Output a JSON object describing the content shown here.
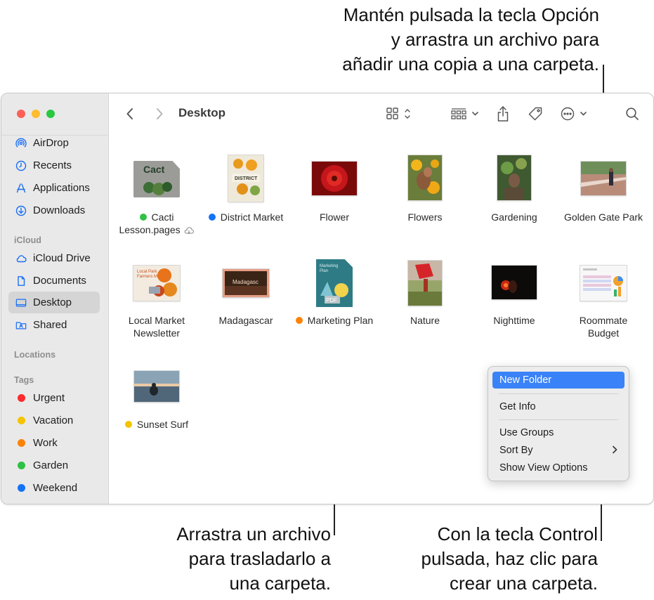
{
  "callouts": {
    "top_right": [
      "Mantén pulsada la tecla Opción",
      "y arrastra un archivo para",
      "añadir una copia a una carpeta."
    ],
    "bottom_middle": [
      "Arrastra un archivo",
      "para trasladarlo a",
      "una carpeta."
    ],
    "bottom_right": [
      "Con la tecla Control",
      "pulsada, haz clic para",
      "crear una carpeta."
    ]
  },
  "window": {
    "title": "Desktop"
  },
  "sidebar": {
    "favorites": [
      {
        "label": "AirDrop",
        "icon": "airdrop-icon"
      },
      {
        "label": "Recents",
        "icon": "clock-icon"
      },
      {
        "label": "Applications",
        "icon": "applications-icon"
      },
      {
        "label": "Downloads",
        "icon": "download-icon"
      }
    ],
    "icloud_header": "iCloud",
    "icloud": [
      {
        "label": "iCloud Drive",
        "icon": "cloud-icon"
      },
      {
        "label": "Documents",
        "icon": "document-icon"
      },
      {
        "label": "Desktop",
        "icon": "desktop-icon",
        "selected": true
      },
      {
        "label": "Shared",
        "icon": "shared-folder-icon"
      }
    ],
    "locations_header": "Locations",
    "tags_header": "Tags",
    "tags": [
      {
        "label": "Urgent",
        "color": "#fc2b2d"
      },
      {
        "label": "Vacation",
        "color": "#f5c400"
      },
      {
        "label": "Work",
        "color": "#fd8208"
      },
      {
        "label": "Garden",
        "color": "#2fc145"
      },
      {
        "label": "Weekend",
        "color": "#1473f5"
      }
    ]
  },
  "toolbar": {
    "icons": [
      "back-icon",
      "forward-icon",
      "grid-view-icon",
      "group-icon",
      "share-icon",
      "tag-icon",
      "more-icon",
      "search-icon"
    ]
  },
  "files": [
    {
      "line1": "Cacti",
      "line2": "Lesson.pages",
      "tag": "#2fc145",
      "icloud": true
    },
    {
      "line1": "District Market",
      "line2": "",
      "tag": "#1473f5"
    },
    {
      "line1": "Flower",
      "line2": ""
    },
    {
      "line1": "Flowers",
      "line2": ""
    },
    {
      "line1": "Gardening",
      "line2": ""
    },
    {
      "line1": "Golden Gate Park",
      "line2": ""
    },
    {
      "line1": "Local Market",
      "line2": "Newsletter"
    },
    {
      "line1": "Madagascar",
      "line2": ""
    },
    {
      "line1": "Marketing Plan",
      "line2": "",
      "tag": "#fd8208"
    },
    {
      "line1": "Nature",
      "line2": ""
    },
    {
      "line1": "Nighttime",
      "line2": ""
    },
    {
      "line1": "Roommate",
      "line2": "Budget"
    },
    {
      "line1": "Sunset Surf",
      "line2": "",
      "tag": "#f5c400"
    }
  ],
  "context_menu": {
    "new_folder": "New Folder",
    "get_info": "Get Info",
    "use_groups": "Use Groups",
    "sort_by": "Sort By",
    "show_view_options": "Show View Options"
  }
}
